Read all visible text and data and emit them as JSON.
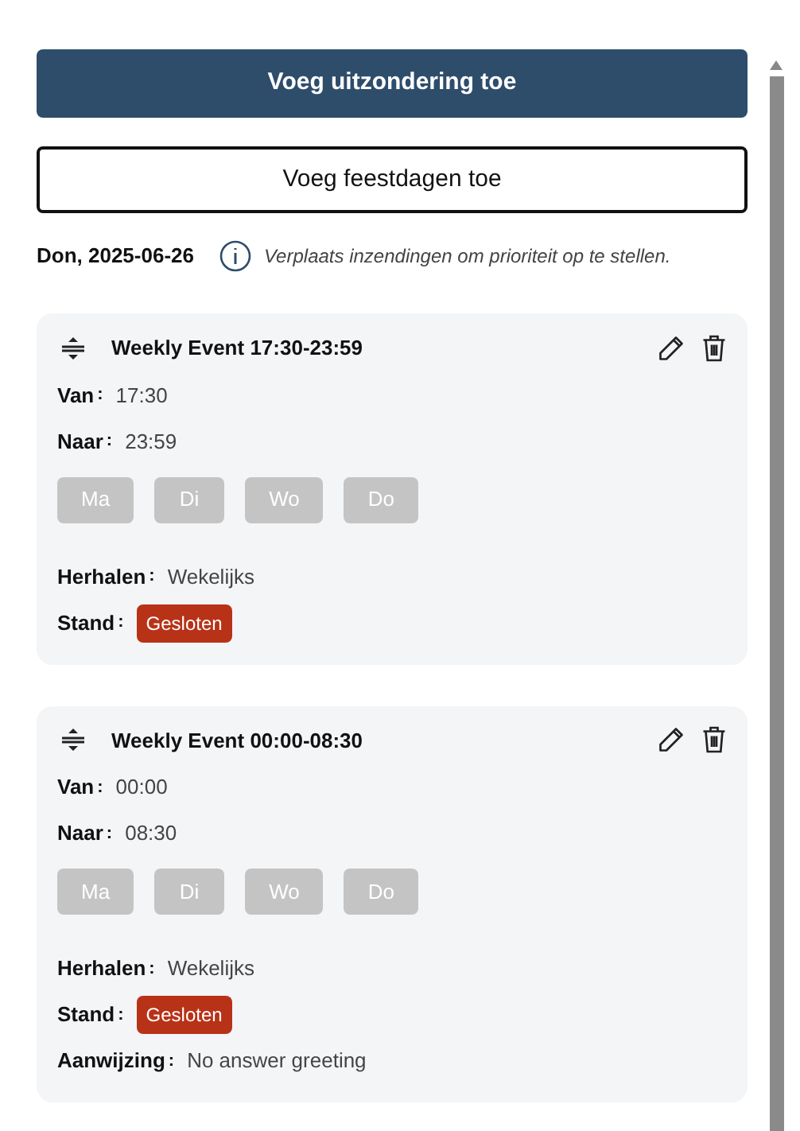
{
  "buttons": [
    {
      "label": "Voeg uitzondering toe",
      "kind": "primary"
    },
    {
      "label": "Voeg feestdagen toe",
      "kind": "outline"
    }
  ],
  "date": "Don, 2025-06-26",
  "hint": "Verplaats inzendingen om prioriteit op te stellen.",
  "events": [
    {
      "title": "Weekly Event 17:30-23:59",
      "top_fields": [
        {
          "label": "Van",
          "separator": ":",
          "value": "17:30",
          "kind": "text"
        },
        {
          "label": "Naar",
          "separator": ":",
          "value": "23:59",
          "kind": "text"
        }
      ],
      "days": [
        {
          "label": "Ma",
          "selected": false
        },
        {
          "label": "Di",
          "selected": false
        },
        {
          "label": "Wo",
          "selected": false
        },
        {
          "label": "Do",
          "selected": false
        }
      ],
      "fields": [
        {
          "label": "Herhalen",
          "separator": ":",
          "value": "Wekelijks",
          "kind": "text"
        },
        {
          "label": "Stand",
          "separator": ":",
          "value": "Gesloten",
          "kind": "badge",
          "color": "#b83218"
        }
      ]
    },
    {
      "title": "Weekly Event 00:00-08:30",
      "top_fields": [
        {
          "label": "Van",
          "separator": ":",
          "value": "00:00",
          "kind": "text"
        },
        {
          "label": "Naar",
          "separator": ":",
          "value": "08:30",
          "kind": "text"
        }
      ],
      "days": [
        {
          "label": "Ma",
          "selected": false
        },
        {
          "label": "Di",
          "selected": false
        },
        {
          "label": "Wo",
          "selected": false
        },
        {
          "label": "Do",
          "selected": false
        }
      ],
      "fields": [
        {
          "label": "Herhalen",
          "separator": ":",
          "value": "Wekelijks",
          "kind": "text"
        },
        {
          "label": "Stand",
          "separator": ":",
          "value": "Gesloten",
          "kind": "badge",
          "color": "#b83218"
        },
        {
          "label": "Aanwijzing",
          "separator": ":",
          "value": "No answer greeting",
          "kind": "text"
        }
      ]
    }
  ]
}
